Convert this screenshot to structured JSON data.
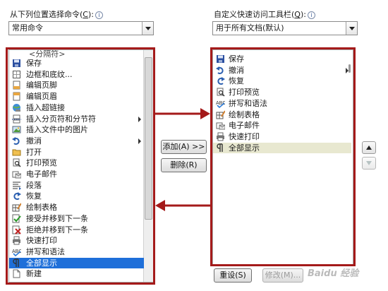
{
  "left_panel": {
    "label": "从下列位置选择命令(",
    "label_key": "C",
    "label_end": "):",
    "combo_value": "常用命令",
    "partial_top": "<分隔符>",
    "items": [
      {
        "label": "保存",
        "icon": "save-icon"
      },
      {
        "label": "边框和底纹...",
        "icon": "borders-icon"
      },
      {
        "label": "编辑页脚",
        "icon": "footer-icon"
      },
      {
        "label": "编辑页眉",
        "icon": "header-icon"
      },
      {
        "label": "插入超链接",
        "icon": "hyperlink-icon"
      },
      {
        "label": "插入分页符和分节符",
        "icon": "page-break-icon",
        "submenu": true
      },
      {
        "label": "插入文件中的图片",
        "icon": "picture-icon"
      },
      {
        "label": "撤消",
        "icon": "undo-icon",
        "submenu": true
      },
      {
        "label": "打开",
        "icon": "open-folder-icon"
      },
      {
        "label": "打印预览",
        "icon": "print-preview-icon"
      },
      {
        "label": "电子邮件",
        "icon": "email-icon"
      },
      {
        "label": "段落",
        "icon": "paragraph-icon"
      },
      {
        "label": "恢复",
        "icon": "redo-icon"
      },
      {
        "label": "绘制表格",
        "icon": "draw-table-icon"
      },
      {
        "label": "接受并移到下一条",
        "icon": "accept-change-icon"
      },
      {
        "label": "拒绝并移到下一条",
        "icon": "reject-change-icon"
      },
      {
        "label": "快速打印",
        "icon": "quick-print-icon"
      },
      {
        "label": "拼写和语法",
        "icon": "spelling-icon"
      },
      {
        "label": "全部显示",
        "icon": "show-all-icon",
        "selected": true
      },
      {
        "label": "新建",
        "icon": "new-document-icon"
      }
    ]
  },
  "right_panel": {
    "label": "自定义快速访问工具栏(",
    "label_key": "Q",
    "label_end": "):",
    "combo_value": "用于所有文档(默认)",
    "items": [
      {
        "label": "保存",
        "icon": "save-icon"
      },
      {
        "label": "撤消",
        "icon": "undo-icon",
        "submenu": true
      },
      {
        "label": "恢复",
        "icon": "redo-icon"
      },
      {
        "label": "打印预览",
        "icon": "print-preview-icon"
      },
      {
        "label": "拼写和语法",
        "icon": "spelling-icon"
      },
      {
        "label": "绘制表格",
        "icon": "draw-table-icon"
      },
      {
        "label": "电子邮件",
        "icon": "email-icon"
      },
      {
        "label": "快速打印",
        "icon": "quick-print-icon"
      },
      {
        "label": "全部显示",
        "icon": "show-all-icon",
        "highlighted": true
      }
    ]
  },
  "buttons": {
    "add": "添加(A) >>",
    "remove": "删除(R)",
    "reset": "重设(S)",
    "modify": "修改(M)..."
  },
  "watermark": "Baidu 经验",
  "colors": {
    "annotation": "#a41a1a",
    "selection": "#1e6fd9"
  }
}
